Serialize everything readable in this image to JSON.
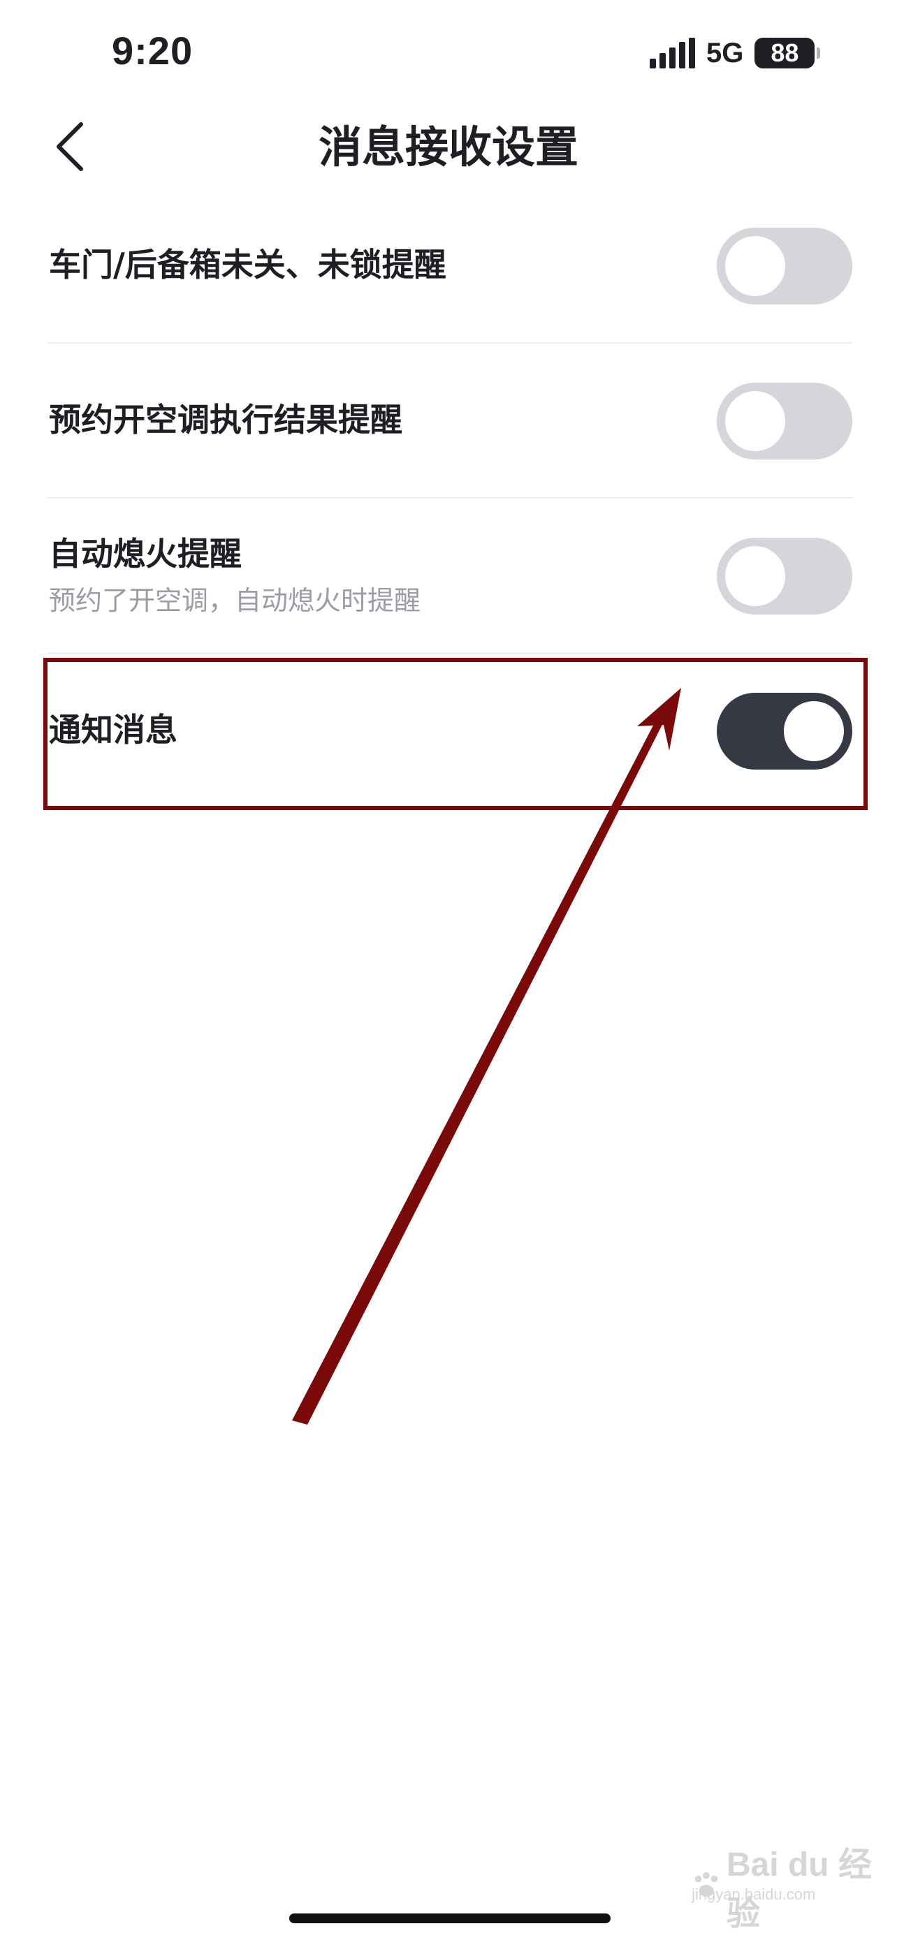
{
  "status_bar": {
    "time": "9:20",
    "network": "5G",
    "battery": "88",
    "signal_icon": "signal-icon",
    "battery_icon": "battery-icon"
  },
  "header": {
    "back_icon": "chevron-left-icon",
    "title": "消息接收设置"
  },
  "settings": {
    "items": [
      {
        "label": "车门/后备箱未关、未锁提醒",
        "enabled": false
      },
      {
        "label": "预约开空调执行结果提醒",
        "enabled": false
      },
      {
        "label": "自动熄火提醒",
        "description": "预约了开空调，自动熄火时提醒",
        "enabled": false
      },
      {
        "label": "通知消息",
        "enabled": true
      }
    ]
  },
  "annotation": {
    "color": "#7a0a0a"
  },
  "watermark": {
    "text": "Bai du 经验",
    "sub": "jingyan.baidu.com"
  },
  "colors": {
    "toggle_on": "#363943",
    "toggle_off": "#d4d6db",
    "text_primary": "#1e1f24",
    "text_secondary": "#9a9ca6"
  }
}
